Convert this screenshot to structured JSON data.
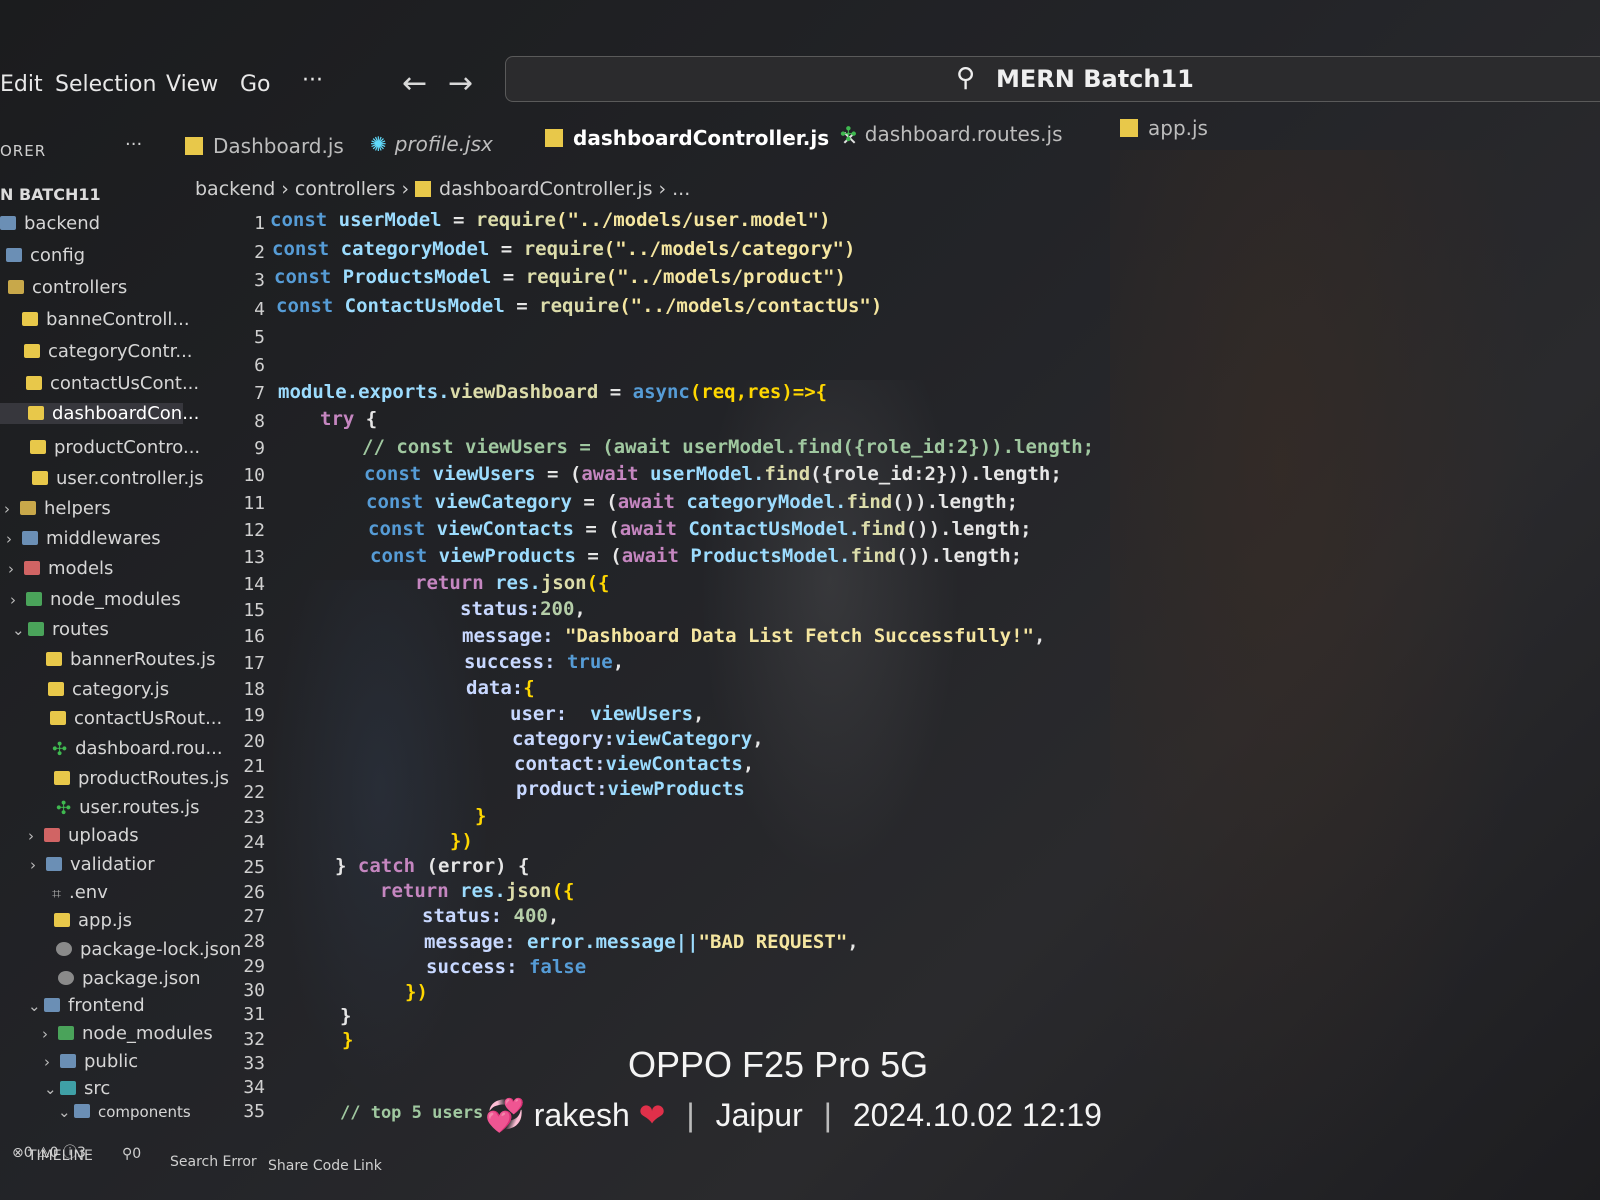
{
  "menu": {
    "items": [
      "Edit",
      "Selection",
      "View",
      "Go",
      "···"
    ],
    "back_icon": "arrow-left",
    "forward_icon": "arrow-right"
  },
  "command_center": {
    "text": "MERN Batch11",
    "icon": "search-icon"
  },
  "explorer": {
    "title": "ORER",
    "more": "···",
    "root": "N BATCH11"
  },
  "tabs": [
    {
      "label": "Dashboard.js",
      "icon": "js"
    },
    {
      "label": "profile.jsx",
      "icon": "react"
    },
    {
      "label": "dashboardController.js",
      "icon": "js",
      "active": true,
      "close": "✕"
    },
    {
      "label": "dashboard.routes.js",
      "icon": "route"
    },
    {
      "label": "app.js",
      "icon": "js"
    }
  ],
  "breadcrumb": {
    "parts": [
      "backend",
      "controllers",
      "dashboardController.js",
      "..."
    ]
  },
  "tree": [
    {
      "label": "backend"
    },
    {
      "label": "config"
    },
    {
      "label": "controllers"
    },
    {
      "label": "banneControll..."
    },
    {
      "label": "categoryContr..."
    },
    {
      "label": "contactUsCont..."
    },
    {
      "label": "dashboardCon...",
      "selected": true
    },
    {
      "label": "productContro..."
    },
    {
      "label": "user.controller.js"
    },
    {
      "label": "helpers"
    },
    {
      "label": "middlewares"
    },
    {
      "label": "models"
    },
    {
      "label": "node_modules"
    },
    {
      "label": "routes"
    },
    {
      "label": "bannerRoutes.js"
    },
    {
      "label": "category.js"
    },
    {
      "label": "contactUsRout..."
    },
    {
      "label": "dashboard.rou..."
    },
    {
      "label": "productRoutes.js"
    },
    {
      "label": "user.routes.js"
    },
    {
      "label": "uploads"
    },
    {
      "label": "validatior"
    },
    {
      "label": ".env"
    },
    {
      "label": "app.js"
    },
    {
      "label": "package-lock.json"
    },
    {
      "label": "package.json"
    },
    {
      "label": "frontend"
    },
    {
      "label": "node_modules"
    },
    {
      "label": "public"
    },
    {
      "label": "src"
    },
    {
      "label": "components"
    }
  ],
  "line_numbers": [
    "1",
    "2",
    "3",
    "4",
    "5",
    "6",
    "7",
    "8",
    "9",
    "10",
    "11",
    "12",
    "13",
    "14",
    "15",
    "16",
    "17",
    "18",
    "19",
    "20",
    "21",
    "22",
    "23",
    "24",
    "25",
    "26",
    "27",
    "28",
    "29",
    "30",
    "31",
    "32",
    "33",
    "34",
    "35"
  ],
  "code": {
    "l1": {
      "a": "const ",
      "b": "userModel",
      "c": " = ",
      "d": "require",
      "e": "(\"../models/user.model\")"
    },
    "l2": {
      "a": "const ",
      "b": "categoryModel",
      "c": " = ",
      "d": "require",
      "e": "(\"../models/category\")"
    },
    "l3": {
      "a": "const ",
      "b": "ProductsModel",
      "c": " = ",
      "d": "require",
      "e": "(\"../models/product\")"
    },
    "l4": {
      "a": "const ",
      "b": "ContactUsModel",
      "c": " = ",
      "d": "require",
      "e": "(\"../models/contactUs\")"
    },
    "l7": {
      "a": "module.exports.",
      "b": "viewDashboard",
      "c": " = ",
      "d": "async",
      "e": "(req,res)=>{"
    },
    "l8": {
      "a": "try",
      "b": " {"
    },
    "l9": "// const viewUsers = (await userModel.find({role_id:2})).length;",
    "l10": {
      "a": "const ",
      "b": "viewUsers",
      "c": " = (",
      "d": "await ",
      "e": "userModel.",
      "f": "find",
      "g": "({role_id:2})).length;"
    },
    "l11": {
      "a": "const ",
      "b": "viewCategory",
      "c": " = (",
      "d": "await ",
      "e": "categoryModel.",
      "f": "find",
      "g": "()).length;"
    },
    "l12": {
      "a": "const ",
      "b": "viewContacts",
      "c": " = (",
      "d": "await ",
      "e": "ContactUsModel.",
      "f": "find",
      "g": "()).length;"
    },
    "l13": {
      "a": "const ",
      "b": "viewProducts",
      "c": " = (",
      "d": "await ",
      "e": "ProductsModel.",
      "f": "find",
      "g": "()).length;"
    },
    "l14": {
      "a": "return ",
      "b": "res.",
      "c": "json",
      "d": "({"
    },
    "l15": {
      "a": "status:",
      "b": "200",
      "c": ","
    },
    "l16": {
      "a": "message: ",
      "b": "\"Dashboard Data List Fetch Successfully!\"",
      "c": ","
    },
    "l17": {
      "a": "success: ",
      "b": "true",
      "c": ","
    },
    "l18": {
      "a": "data:",
      "b": "{"
    },
    "l19": {
      "a": "user:  ",
      "b": "viewUsers",
      "c": ","
    },
    "l20": {
      "a": "category:",
      "b": "viewCategory",
      "c": ","
    },
    "l21": {
      "a": "contact:",
      "b": "viewContacts",
      "c": ","
    },
    "l22": {
      "a": "product:",
      "b": "viewProducts"
    },
    "l23": "}",
    "l24": "})",
    "l25": {
      "a": "} ",
      "b": "catch",
      "c": " (error) {"
    },
    "l26": {
      "a": "return ",
      "b": "res.",
      "c": "json",
      "d": "({"
    },
    "l27": {
      "a": "status: ",
      "b": "400",
      "c": ","
    },
    "l28": {
      "a": "message: ",
      "b": "error.message||",
      "c": "\"BAD REQUEST\"",
      "d": ","
    },
    "l29": {
      "a": "success: ",
      "b": "false"
    },
    "l30": "})",
    "l31": "}",
    "l32": "}",
    "l35": "// top 5 users"
  },
  "statusbar": {
    "timeline": "TIMELINE",
    "problems": "⊗0 ⚠0 ⓘ3",
    "ports": "⚲0",
    "search_error": "Search Error",
    "share": "Share Code Link"
  },
  "watermark": {
    "device": "OPPO F25 Pro 5G",
    "name_prefix": "💞",
    "name": "rakesh",
    "heart": "❤",
    "city": "Jaipur",
    "datetime": "2024.10.02 12:19"
  }
}
